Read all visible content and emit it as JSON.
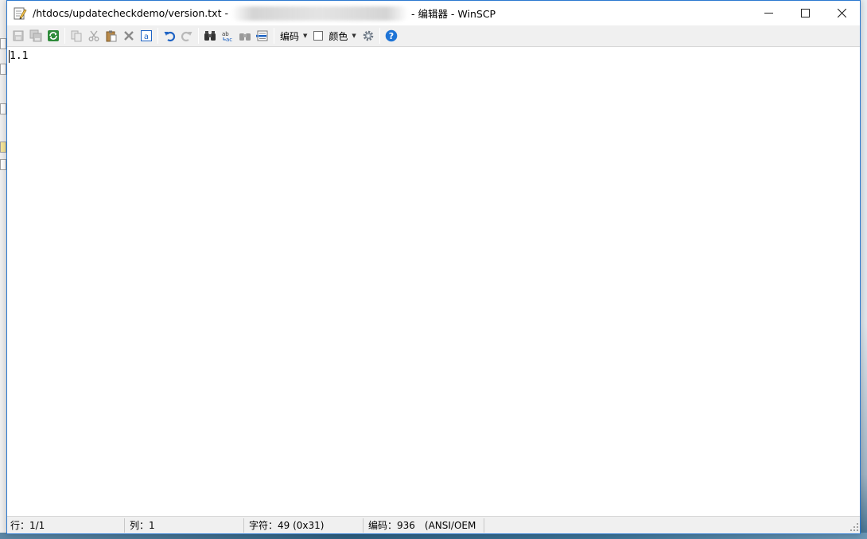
{
  "window": {
    "title_prefix": "/htdocs/updatecheckdemo/version.txt -",
    "title_suffix": "- 编辑器 - WinSCP"
  },
  "toolbar": {
    "encoding_label": "编码",
    "color_label": "颜色"
  },
  "editor": {
    "content": "1.1"
  },
  "statusbar": {
    "line": "行：1/1",
    "column": "列：1",
    "char": "字符：49 (0x31)",
    "encoding": "编码：936　(ANSI/OEM"
  },
  "colors": {
    "accent": "#2b79d0",
    "undo_blue": "#1e63c4",
    "help_blue": "#1e74d6",
    "refresh_green": "#2e8b3a"
  }
}
